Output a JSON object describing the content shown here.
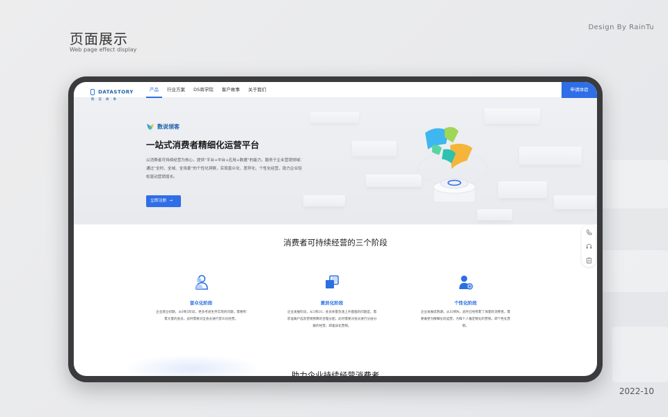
{
  "presentation": {
    "title": "页面展示",
    "subtitle": "Web page effect display",
    "credit": "Design By RainTu",
    "date": "2022-10"
  },
  "nav": {
    "logo_text": "DATASTORY",
    "logo_sub": "数说故事",
    "items": [
      {
        "label": "产品",
        "active": true
      },
      {
        "label": "行业方案",
        "active": false
      },
      {
        "label": "DS商学院",
        "active": false
      },
      {
        "label": "客户故事",
        "active": false
      },
      {
        "label": "关于我们",
        "active": false
      }
    ],
    "cta": "申请体验"
  },
  "hero": {
    "brand": "数说领客",
    "title": "一站式消费者精细化运营平台",
    "description": "以消费者可持续经营为核心，提供“平台+中台+应用+数据”的能力，服务于企业营销领域：通过“全时、全域、全场景”的个性化洞察，实现普众化、差异化、个性化经营，助力企业轻松驱动营销增长。",
    "button": "立即注册",
    "button_arrow": "→"
  },
  "stages_section": {
    "title": "消费者可持续经营的三个阶段",
    "stages": [
      {
        "name": "普众化阶段",
        "icon": "users-icon",
        "description": "企业建立初期，从0到1阶段，更多考虑生存实现的问题，需要积累大量的会员，此时需要对全会员进行普众化经营。"
      },
      {
        "name": "差异化阶段",
        "icon": "layers-icon",
        "description": "企业发展阶段，从1到10，会员体量急速上升面临的问题是，需求准确户选及营销预算的合理分配，此时需要对会员进行分层分群的经营，即差异化营销。"
      },
      {
        "name": "个性化阶段",
        "icon": "user-settings-icon",
        "description": "企业发展成熟期，从10到N，此时已经积累了海量的消费者，需要做更为精细化的运营，为每个人做定制化的营销，即个性化营销。"
      }
    ]
  },
  "next_section": {
    "title": "助力企业持续经营消费者"
  },
  "side_tools": [
    "phone-icon",
    "headset-icon",
    "clipboard-icon"
  ],
  "colors": {
    "accent": "#2f6ee6",
    "brand": "#1f5fa8"
  }
}
